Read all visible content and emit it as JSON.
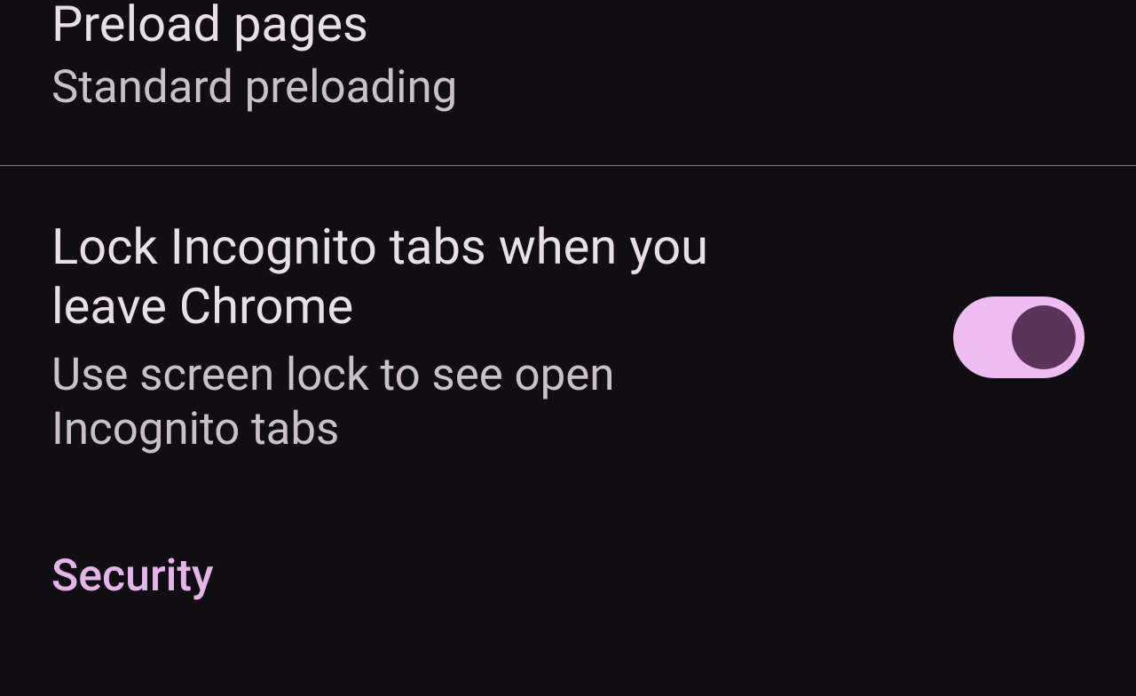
{
  "settings": {
    "preload": {
      "title": "Preload pages",
      "subtitle": "Standard preloading"
    },
    "incognito_lock": {
      "title": "Lock Incognito tabs when you leave Chrome",
      "subtitle": "Use screen lock to see open Incognito tabs",
      "enabled": true
    },
    "section_security": "Security"
  }
}
